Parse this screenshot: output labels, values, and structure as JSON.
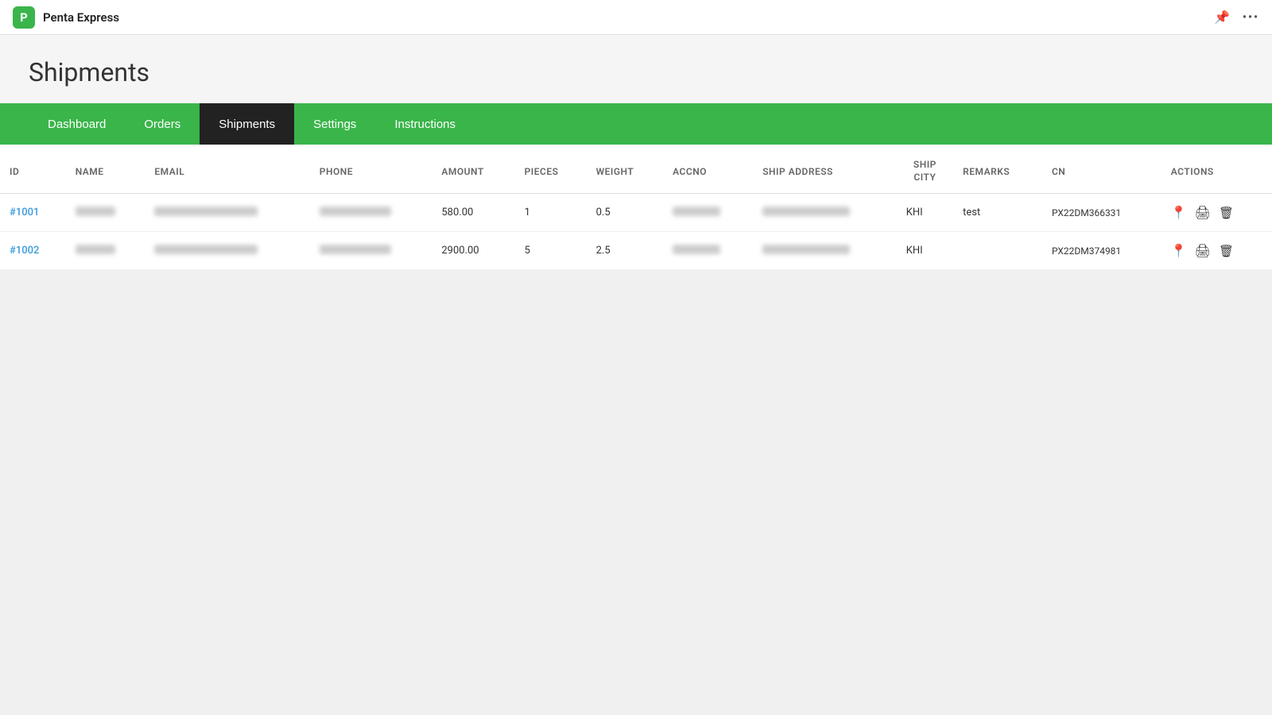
{
  "app": {
    "icon_label": "P",
    "title": "Penta Express",
    "pin_icon": "📌",
    "more_icon": "•••"
  },
  "page": {
    "title": "Shipments"
  },
  "nav": {
    "items": [
      {
        "id": "dashboard",
        "label": "Dashboard",
        "active": false
      },
      {
        "id": "orders",
        "label": "Orders",
        "active": false
      },
      {
        "id": "shipments",
        "label": "Shipments",
        "active": true
      },
      {
        "id": "settings",
        "label": "Settings",
        "active": false
      },
      {
        "id": "instructions",
        "label": "Instructions",
        "active": false
      }
    ]
  },
  "table": {
    "columns": [
      {
        "id": "id",
        "label": "ID"
      },
      {
        "id": "name",
        "label": "NAME"
      },
      {
        "id": "email",
        "label": "EMAIL"
      },
      {
        "id": "phone",
        "label": "PHONE"
      },
      {
        "id": "amount",
        "label": "AMOUNT"
      },
      {
        "id": "pieces",
        "label": "PIECES"
      },
      {
        "id": "weight",
        "label": "WEIGHT"
      },
      {
        "id": "accno",
        "label": "ACCNO"
      },
      {
        "id": "ship_address",
        "label": "SHIP ADDRESS"
      },
      {
        "id": "ship_city",
        "label": "SHIP\nCITY"
      },
      {
        "id": "remarks",
        "label": "REMARKS"
      },
      {
        "id": "cn",
        "label": "CN"
      },
      {
        "id": "actions",
        "label": "ACTIONS"
      }
    ],
    "rows": [
      {
        "id": "#1001",
        "name": "REDACTED",
        "email": "REDACTED",
        "phone": "REDACTED",
        "amount": "580.00",
        "pieces": "1",
        "weight": "0.5",
        "accno": "REDACTED",
        "ship_address": "REDACTED",
        "ship_city": "KHI",
        "remarks": "test",
        "cn": "PX22DM366331"
      },
      {
        "id": "#1002",
        "name": "REDACTED",
        "email": "REDACTED",
        "phone": "REDACTED",
        "amount": "2900.00",
        "pieces": "5",
        "weight": "2.5",
        "accno": "REDACTED",
        "ship_address": "REDACTED",
        "ship_city": "KHI",
        "remarks": "",
        "cn": "PX22DM374981"
      }
    ]
  },
  "colors": {
    "green": "#3ab54a",
    "active_nav": "#222222",
    "link_blue": "#3a9ad9"
  }
}
